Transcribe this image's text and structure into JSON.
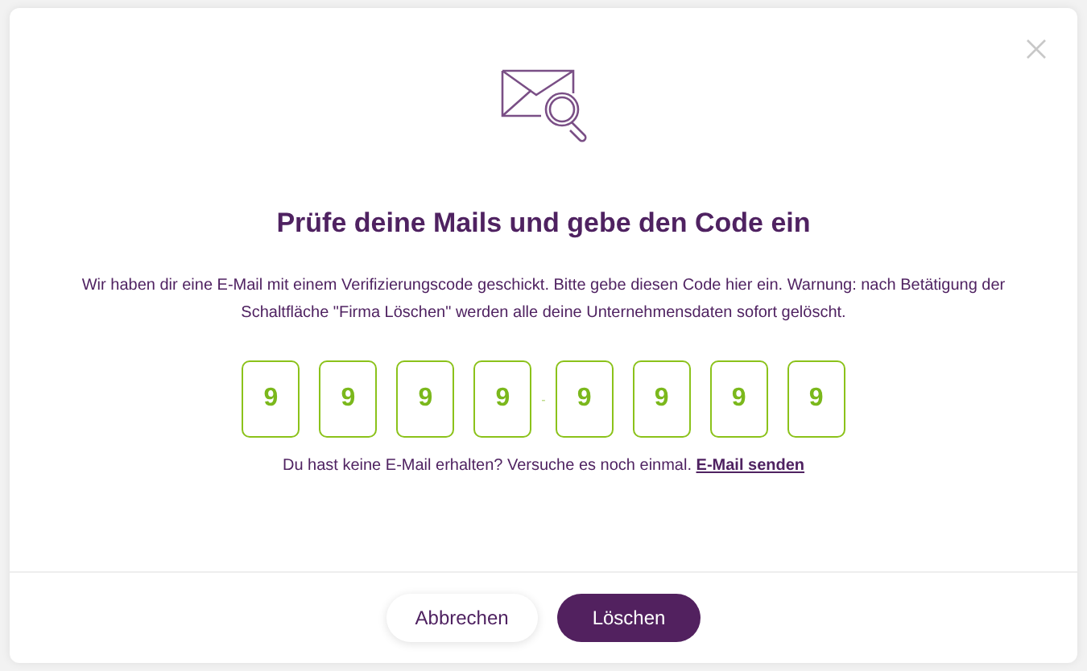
{
  "dialog": {
    "title": "Prüfe deine Mails und gebe den Code ein",
    "message": "Wir haben dir eine E-Mail mit einem Verifizierungscode geschickt. Bitte gebe diesen Code hier ein. Warnung: nach Betätigung der Schaltfläche \"Firma Löschen\" werden alle deine Unternehmensdaten sofort gelöscht.",
    "code_digits": [
      "9",
      "9",
      "9",
      "9",
      "9",
      "9",
      "9",
      "9"
    ],
    "separator": "-",
    "resend_text": "Du hast keine E-Mail erhalten? Versuche es noch einmal.",
    "resend_link": "E-Mail senden",
    "buttons": [
      {
        "label": "Abbrechen",
        "kind": "secondary"
      },
      {
        "label": "Löschen",
        "kind": "primary"
      }
    ]
  }
}
